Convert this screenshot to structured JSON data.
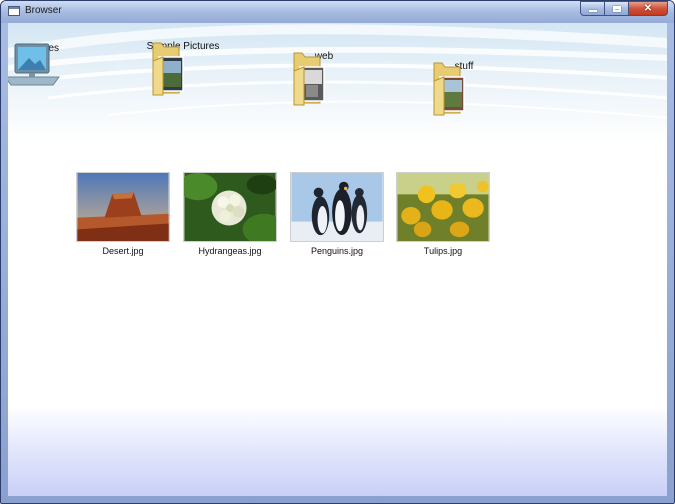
{
  "window": {
    "title": "Browser",
    "icon": "app-window-icon",
    "caption_buttons": {
      "minimize_icon": "minimize-icon",
      "maximize_icon": "maximize-icon",
      "close_icon": "close-icon"
    }
  },
  "navigation": {
    "items": [
      {
        "label": "Pictures",
        "icon": "computer-icon"
      },
      {
        "label": "Sample Pictures",
        "icon": "folder-icon"
      },
      {
        "label": "web",
        "icon": "folder-icon"
      },
      {
        "label": "stuff",
        "icon": "folder-icon"
      }
    ]
  },
  "thumbnails": {
    "items": [
      {
        "label": "Desert.jpg",
        "icon": "desert-image"
      },
      {
        "label": "Hydrangeas.jpg",
        "icon": "hydrangeas-image"
      },
      {
        "label": "Penguins.jpg",
        "icon": "penguins-image"
      },
      {
        "label": "Tulips.jpg",
        "icon": "tulips-image"
      }
    ]
  },
  "colors": {
    "frame": "#95aad5",
    "close_button": "#c94a2f",
    "background": "#ffffff",
    "footer_tint": "#c9d0f6"
  }
}
